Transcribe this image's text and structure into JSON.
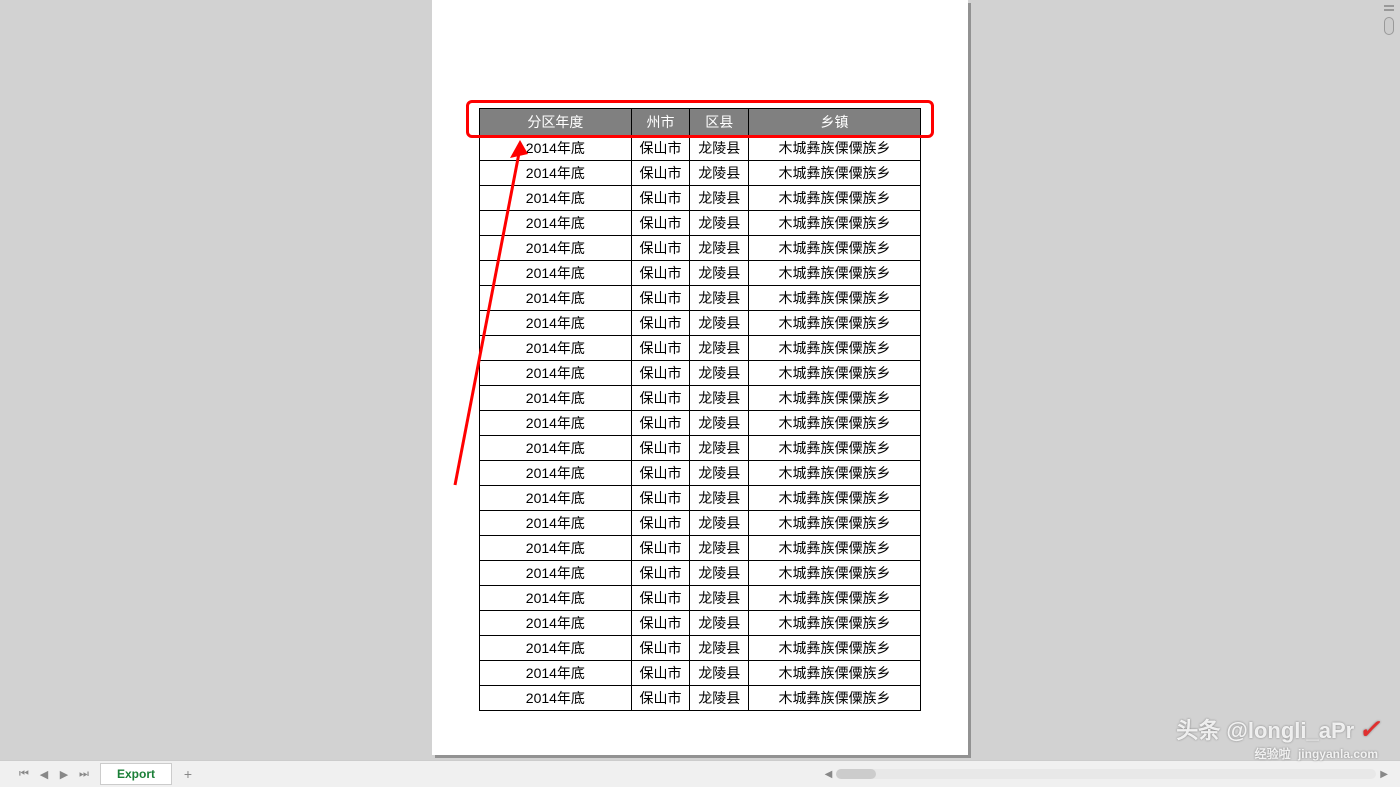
{
  "table": {
    "headers": [
      "分区年度",
      "州市",
      "区县",
      "乡镇"
    ],
    "row": {
      "year": "2014年底",
      "city": "保山市",
      "county": "龙陵县",
      "town": "木城彝族傈僳族乡"
    },
    "row_count": 23
  },
  "bottom": {
    "sheet_tab": "Export"
  },
  "watermark": {
    "top": "头条 @longli_aPr",
    "bottom": "经验啦",
    "site": "jingyanla.com"
  }
}
